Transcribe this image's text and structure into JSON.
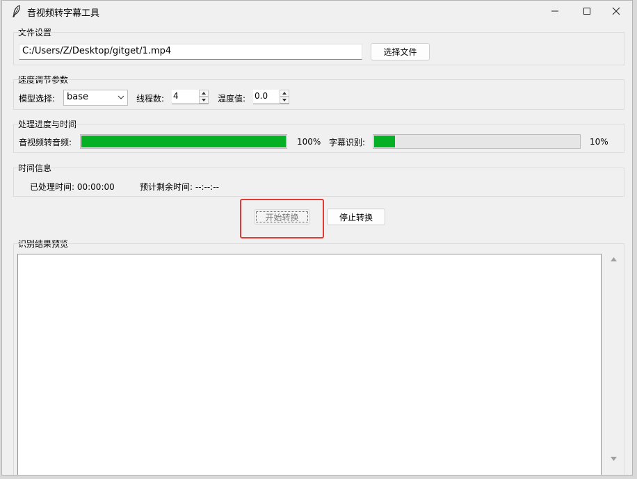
{
  "window": {
    "title": "音视频转字幕工具"
  },
  "file_settings": {
    "group_title": "文件设置",
    "path_value": "C:/Users/Z/Desktop/gitget/1.mp4",
    "select_button": "选择文件"
  },
  "speed_params": {
    "group_title": "速度调节参数",
    "model_label": "模型选择:",
    "model_value": "base",
    "threads_label": "线程数:",
    "threads_value": "4",
    "temperature_label": "温度值:",
    "temperature_value": "0.0"
  },
  "progress": {
    "group_title": "处理进度与时间",
    "audio_label": "音视频转音频:",
    "audio_percent_text": "100%",
    "audio_fraction": 1.0,
    "subtitle_label": "字幕识别:",
    "subtitle_percent_text": "10%",
    "subtitle_fraction": 0.1,
    "bar_color": "#06b025"
  },
  "time_info": {
    "group_title": "时间信息",
    "elapsed_text": "已处理时间: 00:00:00",
    "remaining_text": "预计剩余时间: --:--:--"
  },
  "actions": {
    "start_button": "开始转换",
    "stop_button": "停止转换",
    "highlight_color": "#e53935"
  },
  "preview": {
    "group_title": "识别结果预览",
    "content": ""
  }
}
